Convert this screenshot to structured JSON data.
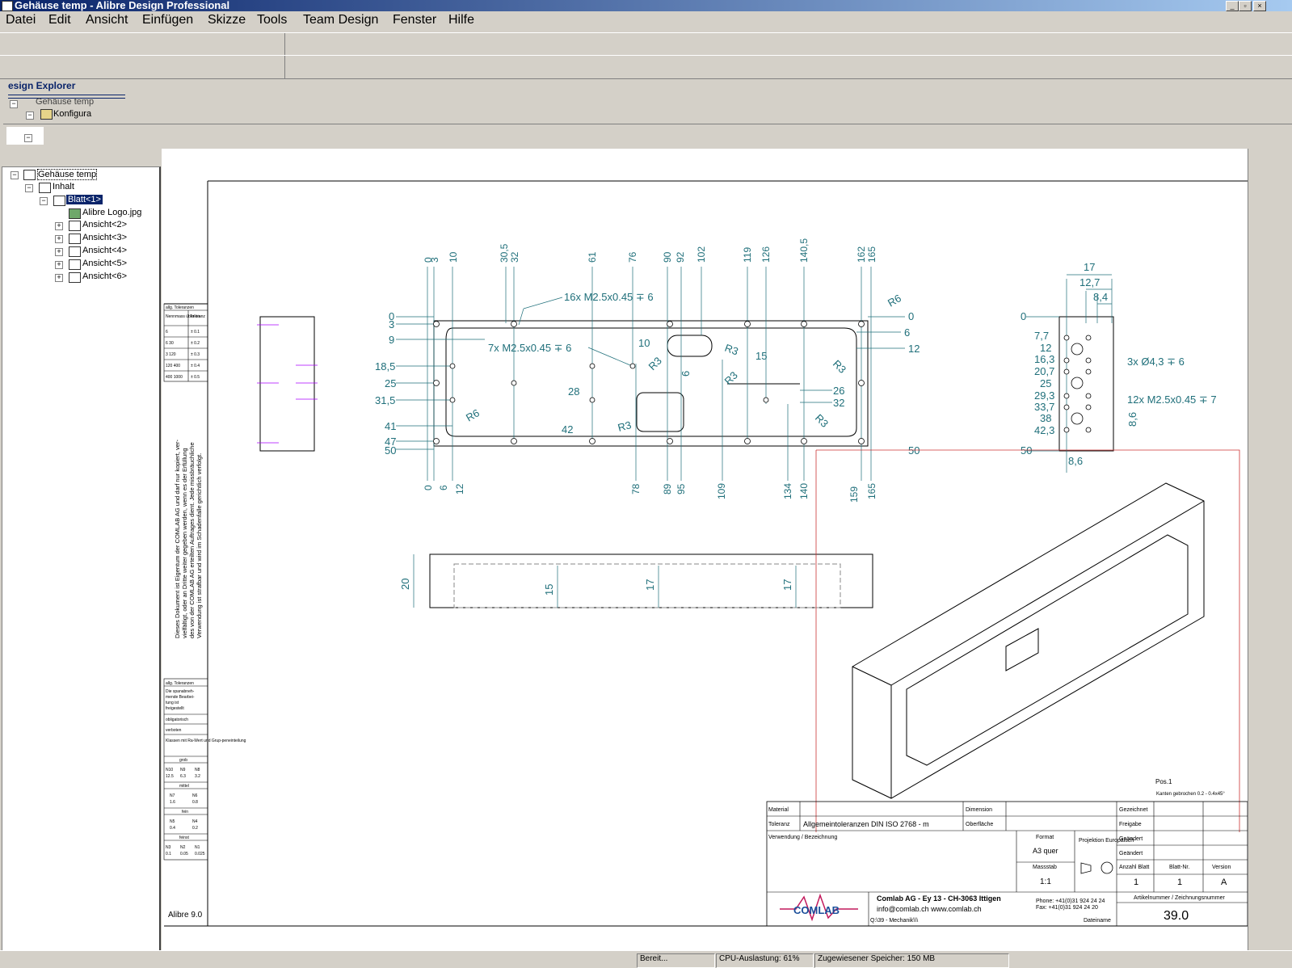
{
  "window": {
    "title": "Gehäuse temp - Alibre Design Professional"
  },
  "menu": [
    "Datei",
    "Edit",
    "Ansicht",
    "Einfügen",
    "Skizze",
    "Tools",
    "Team Design",
    "Fenster",
    "Hilfe"
  ],
  "explorer": {
    "header": "esign Explorer",
    "mini_item": "Konfigura",
    "mini_root": "Gehäuse temp"
  },
  "tree": {
    "root": "Gehäuse temp",
    "content": "Inhalt",
    "sheet": "Blatt<1>",
    "logo": "Alibre Logo.jpg",
    "views": [
      "Ansicht<2>",
      "Ansicht<3>",
      "Ansicht<4>",
      "Ansicht<5>",
      "Ansicht<6>"
    ]
  },
  "drawing": {
    "top_dims": [
      "0",
      "3",
      "10",
      "30,5",
      "32",
      "61",
      "76",
      "90",
      "92",
      "102",
      "119",
      "126",
      "140,5",
      "162",
      "165"
    ],
    "bottom_dims": [
      "0",
      "6",
      "12",
      "78",
      "89",
      "95",
      "109",
      "134",
      "140",
      "159",
      "165"
    ],
    "left_dims": [
      "0",
      "3",
      "9",
      "18,5",
      "25",
      "31,5",
      "41",
      "47",
      "50"
    ],
    "right_dims": [
      "0",
      "6",
      "12",
      "26",
      "32",
      "50"
    ],
    "callouts": {
      "holes_16": "16x M2.5x0.45 ∓ 6",
      "holes_7": "7x M2.5x0.45 ∓ 6",
      "r6": "R6",
      "r3": "R3",
      "d10": "10",
      "d15": "15",
      "d6": "6",
      "d28": "28",
      "d42": "42"
    },
    "side_dims": {
      "top": [
        "17",
        "12,7",
        "8,4"
      ],
      "left": [
        "0",
        "7,7",
        "12",
        "16,3",
        "20,7",
        "25",
        "29,3",
        "33,7",
        "38",
        "42,3",
        "50"
      ],
      "holes_3": "3x Ø4,3 ∓ 6",
      "holes_12": "12x M2.5x0.45 ∓ 7",
      "v86": "8,6",
      "h86": "8,6"
    },
    "front_dims": [
      "20",
      "15",
      "17",
      "17"
    ],
    "pos": "Pos.1",
    "edges": "Kanten gebrochen 0.2 - 0.4x45°",
    "version_label": "Alibre 9.0",
    "disclaimer": [
      "Dieses Dokument ist Eigentum der COMLAB AG und darf nur kopiert, ver-",
      "vielfältigt, oder an Dritte weiter gegeben werden, wenn es der Erfüllung",
      "des von der COMLAB AG erteilten Auftrages dient. Jede missbräuchliche",
      "Verwendung ist strafbar und wird im Schadenfalle gerichtlich verfolgt."
    ],
    "tol_table": {
      "title": "allg. Toleranzen",
      "col1": "Nennmass über bis",
      "col2": "Toleranz",
      "rows": [
        [
          "6",
          "± 0.1"
        ],
        [
          "6   30",
          "± 0.2"
        ],
        [
          "3   120",
          "± 0.3"
        ],
        [
          "120  400",
          "± 0.4"
        ],
        [
          "400 1000",
          "± 0.5"
        ]
      ]
    },
    "tol2": {
      "title": "allg. Toleranzen",
      "lines": [
        "Die spanabneh-",
        "mende Bearbei-",
        "tung ist",
        "freigestellt"
      ],
      "opt1": "obligatorisch",
      "opt2": "verboten",
      "class": "Klassen mit Ra-Wert und Grup-peneinteilung",
      "g1": "grob",
      "g1v": [
        [
          "N10",
          "N9",
          "N8"
        ],
        [
          "12.5",
          "6.3",
          "3.2"
        ]
      ],
      "g2": "mittel",
      "g2v": [
        [
          "N7",
          "N6"
        ],
        [
          "1.6",
          "0.8"
        ]
      ],
      "g3": "fein",
      "g3v": [
        [
          "N5",
          "N4"
        ],
        [
          "0.4",
          "0.2"
        ]
      ],
      "g4": "feinst",
      "g4v": [
        [
          "N3",
          "N2",
          "N1"
        ],
        [
          "0.1",
          "0.05",
          "0.025"
        ]
      ]
    },
    "title_block": {
      "material_lbl": "Material",
      "toleranz_lbl": "Toleranz",
      "toleranz_val": "Allgemeintoleranzen DIN ISO 2768 - m",
      "dimension_lbl": "Dimension",
      "oberflaeche_lbl": "Oberfläche",
      "verwendung_lbl": "Verwendung / Bezeichnung",
      "format_lbl": "Format",
      "format_val": "A3 quer",
      "projektion_lbl": "Projektion Europäisch",
      "massstab_lbl": "Massstab",
      "massstab_val": "1:1",
      "gezeichnet": "Gezeichnet",
      "gepruft": "Freigabe",
      "geaendert1": "Geändert",
      "geaendert2": "Geändert",
      "anzahl_lbl": "Anzahl Blatt",
      "anzahl_val": "1",
      "blatt_lbl": "Blatt-Nr.",
      "blatt_val": "1",
      "version_lbl": "Version",
      "version_val": "A",
      "company": "Comlab AG - Ey 13 - CH-3063 Ittigen",
      "email": "info@comlab.ch   www.comlab.ch",
      "phone": "Phone: +41(0)31 924 24 24",
      "fax": "Fax:     +41(0)31 924 24 20",
      "path": "Q:\\39 - Mechanik\\\\\\",
      "dateiname": "Dateiname",
      "artikel_lbl": "Artikelnummer / Zeichnungsnummer",
      "artikel_val": "39.0",
      "logo": "COMLAB"
    }
  },
  "status": [
    "Bereit...",
    "CPU-Auslastung: 61%",
    "Zugewiesener Speicher: 150 MB"
  ]
}
